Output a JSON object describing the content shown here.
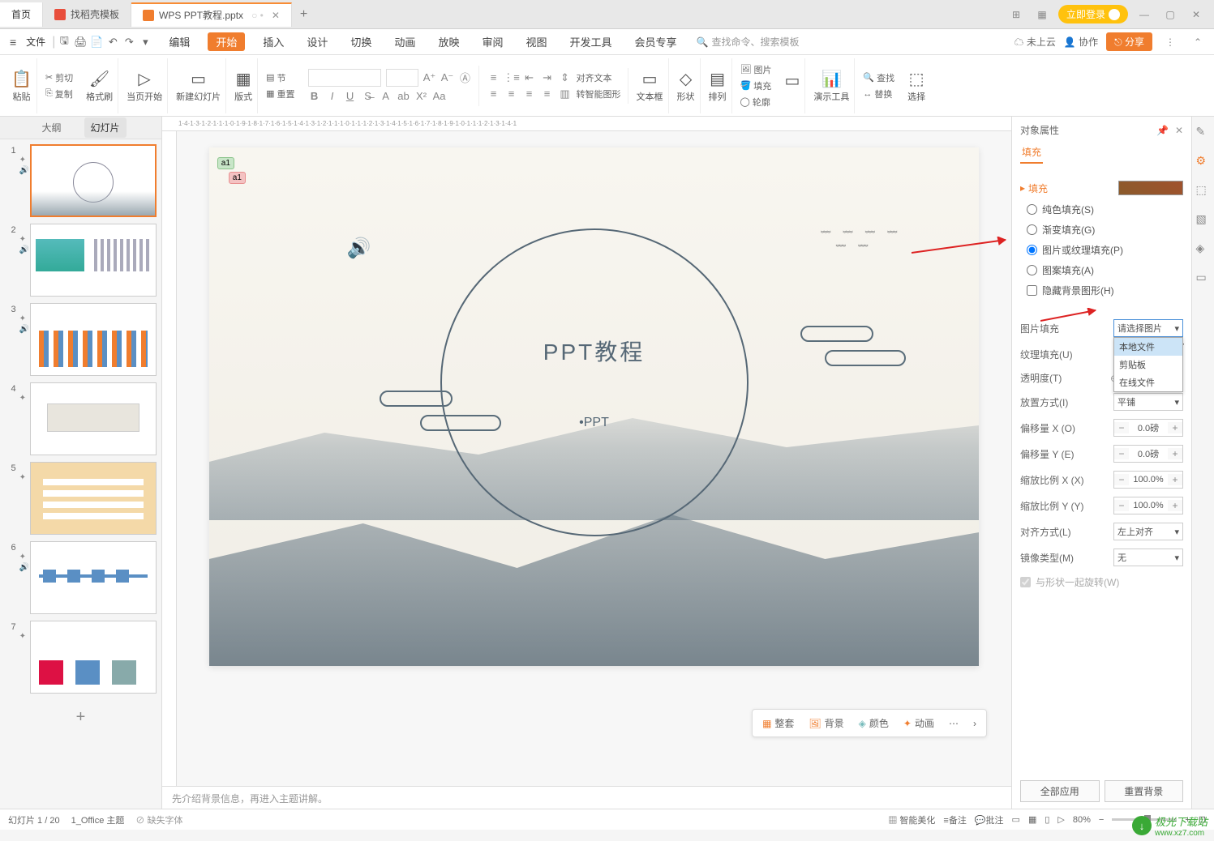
{
  "tabs": {
    "home": "首页",
    "template": "找稻壳模板",
    "doc": "WPS PPT教程.pptx"
  },
  "login": "立即登录",
  "menu": {
    "file": "文件",
    "items": [
      "编辑",
      "开始",
      "插入",
      "设计",
      "切换",
      "动画",
      "放映",
      "审阅",
      "视图",
      "开发工具",
      "会员专享"
    ],
    "search_placeholder": "查找命令、搜索模板",
    "cloud": "未上云",
    "collab": "协作",
    "share": "分享"
  },
  "ribbon": {
    "paste": "粘贴",
    "cut": "剪切",
    "copy": "复制",
    "format_painter": "格式刷",
    "from_start": "当页开始",
    "new_slide": "新建幻灯片",
    "layout": "版式",
    "section": "节",
    "reset": "重置",
    "align_text": "对齐文本",
    "smart_graphic": "转智能图形",
    "text_box": "文本框",
    "shape": "形状",
    "arrange": "排列",
    "picture": "图片",
    "fill_shape": "填充",
    "outline": "轮廓",
    "find": "查找",
    "demo_tools": "演示工具",
    "replace": "替换",
    "select": "选择"
  },
  "sidebar": {
    "outline": "大纲",
    "slides": "幻灯片"
  },
  "slides": [
    {
      "n": "1"
    },
    {
      "n": "2"
    },
    {
      "n": "3"
    },
    {
      "n": "4"
    },
    {
      "n": "5"
    },
    {
      "n": "6"
    },
    {
      "n": "7"
    }
  ],
  "canvas": {
    "title": "PPT教程",
    "sub": "•PPT",
    "tag1": "a1",
    "tag2": "a1"
  },
  "canvas_toolbar": {
    "all": "整套",
    "bg": "背景",
    "color": "颜色",
    "motion": "动画"
  },
  "notes": "先介绍背景信息，再进入主题讲解。",
  "props": {
    "header": "对象属性",
    "tab_fill": "填充",
    "section_fill": "填充",
    "solid": "纯色填充(S)",
    "gradient": "渐变填充(G)",
    "picture": "图片或纹理填充(P)",
    "pattern": "图案填充(A)",
    "hide_bg": "隐藏背景图形(H)",
    "pic_fill": "图片填充",
    "select_pic": "请选择图片",
    "menu_local": "本地文件",
    "menu_clip": "剪贴板",
    "menu_online": "在线文件",
    "texture": "纹理填充(U)",
    "opacity": "透明度(T)",
    "position": "放置方式(I)",
    "tile": "平铺",
    "offx": "偏移量 X (O)",
    "offx_v": "0.0磅",
    "offy": "偏移量 Y (E)",
    "offy_v": "0.0磅",
    "scalex": "缩放比例 X (X)",
    "scalex_v": "100.0%",
    "scaley": "缩放比例 Y (Y)",
    "scaley_v": "100.0%",
    "align": "对齐方式(L)",
    "align_v": "左上对齐",
    "mirror": "镜像类型(M)",
    "mirror_v": "无",
    "rotate": "与形状一起旋转(W)",
    "apply_all": "全部应用",
    "reset_bg": "重置背景"
  },
  "status": {
    "slide_count": "幻灯片 1 / 20",
    "theme": "1_Office 主题",
    "missing_font": "缺失字体",
    "smart_beauty": "智能美化",
    "notes": "备注",
    "comments": "批注",
    "zoom": "80%"
  },
  "watermark": {
    "name": "极光下载站",
    "url": "www.xz7.com"
  }
}
